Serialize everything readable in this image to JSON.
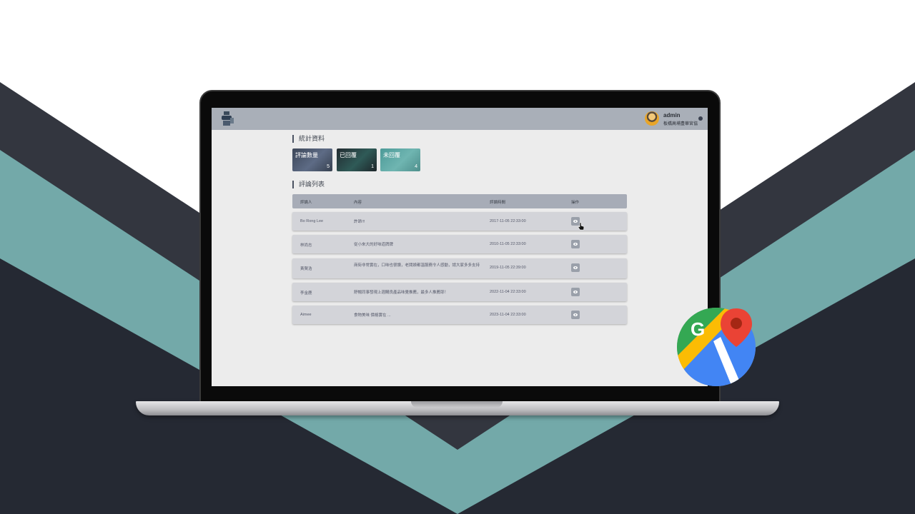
{
  "header": {
    "user_name": "admin",
    "user_org": "板橋高埔豊華宮協"
  },
  "stats": {
    "title": "統計資料",
    "cards": [
      {
        "label": "評論數量",
        "value": "5"
      },
      {
        "label": "已回覆",
        "value": "1"
      },
      {
        "label": "未回覆",
        "value": "4"
      }
    ]
  },
  "reviews": {
    "title": "評論列表",
    "columns": [
      "評論人",
      "內容",
      "評論時間",
      "操作"
    ],
    "rows": [
      {
        "name": "Bo Rong Lee",
        "content": "許昂!!!",
        "date": "2017-11-05 22:33:00"
      },
      {
        "name": "林尚志",
        "content": "從小來大的好味道牌牌",
        "date": "2010-11-05 22:33:00"
      },
      {
        "name": "黃賢浩",
        "content": "商街非常實在，口味也很讚，老闆娘都溫服務令人感動，請大家多多支持",
        "date": "2019-11-05 22:39:00"
      },
      {
        "name": "李金鹿",
        "content": "舒暢同事發現上週購良產品味覺推薦，最多人推薦耶！",
        "date": "2022-11-04 22:33:00"
      },
      {
        "name": "Aimee",
        "content": "食物美味 價格實在 ...",
        "date": "2023-11-04 22:33:00"
      }
    ]
  },
  "colors": {
    "teal": "#73a9a9",
    "dark": "#33363f",
    "darker": "#252933",
    "topbar": "#a9afb8"
  },
  "icons": [
    "google-maps-icon",
    "eye-icon",
    "hand-cursor-icon",
    "user-avatar-icon"
  ]
}
